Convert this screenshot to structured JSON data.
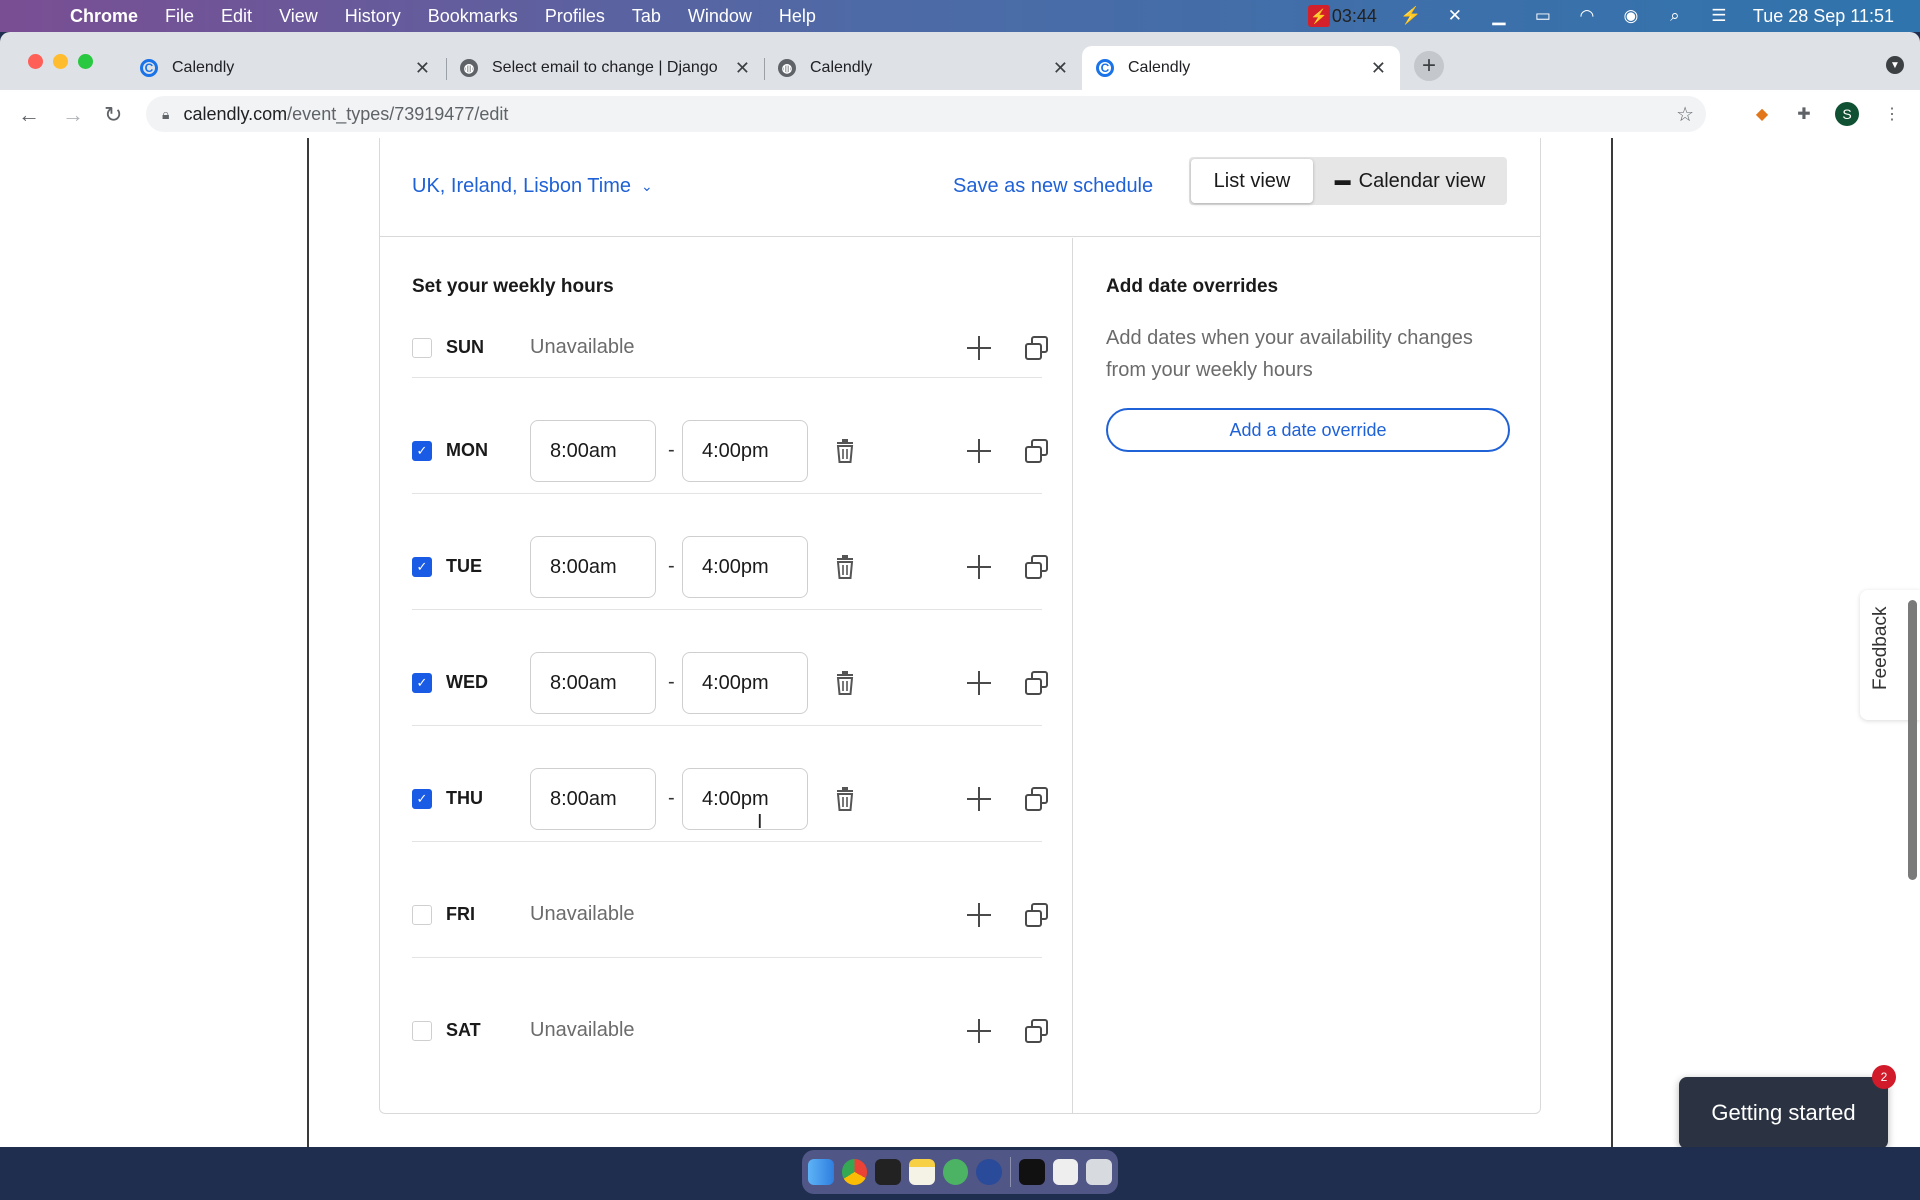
{
  "menubar": {
    "app": "Chrome",
    "items": [
      "File",
      "Edit",
      "View",
      "History",
      "Bookmarks",
      "Profiles",
      "Tab",
      "Window",
      "Help"
    ],
    "recording_time": "03:44",
    "datetime": "Tue 28 Sep  11:51"
  },
  "browser": {
    "tabs": [
      {
        "title": "Calendly",
        "icon": "calendly-icon",
        "active": false
      },
      {
        "title": "Select email to change | Django",
        "icon": "globe-icon",
        "active": false
      },
      {
        "title": "Calendly",
        "icon": "globe-icon",
        "active": false
      },
      {
        "title": "Calendly",
        "icon": "calendly-icon",
        "active": true
      }
    ],
    "url_host": "calendly.com",
    "url_path": "/event_types/73919477/edit",
    "profile_initial": "S"
  },
  "schedule": {
    "timezone": "UK, Ireland, Lisbon Time",
    "save_as_new": "Save as new schedule",
    "views": {
      "list": "List view",
      "calendar": "Calendar view",
      "selected": "list"
    },
    "weekly_title": "Set your weekly hours",
    "days": [
      {
        "day": "SUN",
        "checked": false,
        "status": "Unavailable"
      },
      {
        "day": "MON",
        "checked": true,
        "start": "8:00am",
        "end": "4:00pm"
      },
      {
        "day": "TUE",
        "checked": true,
        "start": "8:00am",
        "end": "4:00pm"
      },
      {
        "day": "WED",
        "checked": true,
        "start": "8:00am",
        "end": "4:00pm"
      },
      {
        "day": "THU",
        "checked": true,
        "start": "8:00am",
        "end": "4:00pm"
      },
      {
        "day": "FRI",
        "checked": false,
        "status": "Unavailable"
      },
      {
        "day": "SAT",
        "checked": false,
        "status": "Unavailable"
      }
    ],
    "separator": "-"
  },
  "overrides": {
    "title": "Add date overrides",
    "description": "Add dates when your availability changes from your weekly hours",
    "button": "Add a date override"
  },
  "widgets": {
    "feedback": "Feedback",
    "getting_started": "Getting started",
    "getting_started_badge": "2"
  },
  "colors": {
    "accent": "#1f61d6",
    "checkbox": "#1a5be6",
    "badge": "#d11a2a"
  }
}
